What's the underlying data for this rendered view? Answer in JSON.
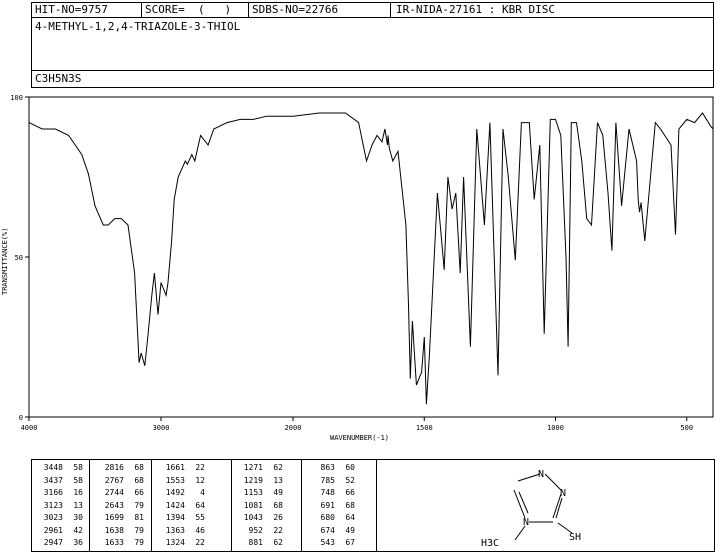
{
  "header": {
    "hit": "HIT-NO=9757",
    "score": "SCORE=  (   )",
    "sdbs": "SDBS-NO=22766",
    "ir": "IR-NIDA-27161 : KBR DISC",
    "compound": "4-METHYL-1,2,4-TRIAZOLE-3-THIOL",
    "formula": "C3H5N3S"
  },
  "chart_data": {
    "type": "line",
    "xlabel": "WAVENUMBER(-1)",
    "ylabel": "TRANSMITTANCE(%)",
    "xlim": [
      4000,
      400
    ],
    "ylim": [
      0,
      100
    ],
    "xticks": [
      "4000",
      "3000",
      "2000",
      "1500",
      "1000",
      "500"
    ],
    "xtick_values": [
      4000,
      3000,
      2000,
      1500,
      1000,
      500
    ],
    "yticks": [
      "0",
      "50",
      "100"
    ],
    "ytick_values": [
      0,
      50,
      100
    ],
    "x": [
      4000,
      3900,
      3800,
      3700,
      3600,
      3550,
      3500,
      3448,
      3437,
      3400,
      3350,
      3300,
      3250,
      3200,
      3166,
      3150,
      3123,
      3100,
      3070,
      3050,
      3023,
      3000,
      2961,
      2947,
      2920,
      2900,
      2870,
      2816,
      2800,
      2767,
      2744,
      2700,
      2643,
      2600,
      2500,
      2400,
      2300,
      2200,
      2100,
      2000,
      1900,
      1800,
      1750,
      1720,
      1699,
      1680,
      1661,
      1650,
      1640,
      1638,
      1633,
      1620,
      1600,
      1570,
      1560,
      1553,
      1545,
      1530,
      1510,
      1500,
      1492,
      1480,
      1450,
      1424,
      1410,
      1394,
      1380,
      1363,
      1350,
      1324,
      1300,
      1271,
      1250,
      1219,
      1200,
      1180,
      1153,
      1130,
      1100,
      1081,
      1060,
      1043,
      1020,
      1000,
      980,
      960,
      952,
      940,
      920,
      900,
      881,
      863,
      840,
      820,
      800,
      785,
      770,
      748,
      720,
      691,
      685,
      680,
      674,
      660,
      620,
      600,
      560,
      543,
      530,
      500,
      470,
      440,
      410,
      400
    ],
    "y": [
      92,
      90,
      90,
      88,
      82,
      76,
      66,
      61,
      60,
      60,
      62,
      62,
      60,
      45,
      17,
      20,
      16,
      25,
      38,
      45,
      32,
      42,
      38,
      42,
      55,
      68,
      75,
      80,
      79,
      82,
      80,
      88,
      85,
      90,
      92,
      93,
      93,
      94,
      94,
      94,
      95,
      95,
      92,
      80,
      85,
      88,
      86,
      90,
      85,
      88,
      84,
      80,
      83,
      60,
      35,
      12,
      30,
      10,
      14,
      25,
      4,
      20,
      70,
      46,
      75,
      65,
      70,
      45,
      75,
      22,
      90,
      60,
      92,
      13,
      90,
      75,
      49,
      92,
      92,
      68,
      85,
      26,
      93,
      93,
      88,
      50,
      22,
      92,
      92,
      80,
      62,
      60,
      92,
      88,
      70,
      52,
      92,
      66,
      90,
      80,
      68,
      64,
      67,
      55,
      92,
      90,
      85,
      57,
      90,
      93,
      92,
      95,
      91,
      90
    ]
  },
  "peaks": [
    [
      "3448",
      "58"
    ],
    [
      "3437",
      "58"
    ],
    [
      "3166",
      "16"
    ],
    [
      "3123",
      "13"
    ],
    [
      "3023",
      "30"
    ],
    [
      "2961",
      "42"
    ],
    [
      "2947",
      "36"
    ],
    [
      "2816",
      "68"
    ],
    [
      "2767",
      "68"
    ],
    [
      "2744",
      "66"
    ],
    [
      "2643",
      "79"
    ],
    [
      "1699",
      "81"
    ],
    [
      "1638",
      "79"
    ],
    [
      "1633",
      "79"
    ],
    [
      "1661",
      "22"
    ],
    [
      "1553",
      "12"
    ],
    [
      "1492",
      "4"
    ],
    [
      "1424",
      "64"
    ],
    [
      "1394",
      "55"
    ],
    [
      "1363",
      "46"
    ],
    [
      "1324",
      "22"
    ],
    [
      "1271",
      "62"
    ],
    [
      "1219",
      "13"
    ],
    [
      "1153",
      "49"
    ],
    [
      "1081",
      "68"
    ],
    [
      "1043",
      "26"
    ],
    [
      "952",
      "22"
    ],
    [
      "881",
      "62"
    ],
    [
      "863",
      "60"
    ],
    [
      "785",
      "52"
    ],
    [
      "748",
      "66"
    ],
    [
      "691",
      "68"
    ],
    [
      "680",
      "64"
    ],
    [
      "674",
      "49"
    ],
    [
      "543",
      "67"
    ]
  ],
  "structure": {
    "n_top": "N",
    "n_right": "N",
    "n_ring": "N",
    "sh": "SH",
    "methyl": "H3C"
  }
}
